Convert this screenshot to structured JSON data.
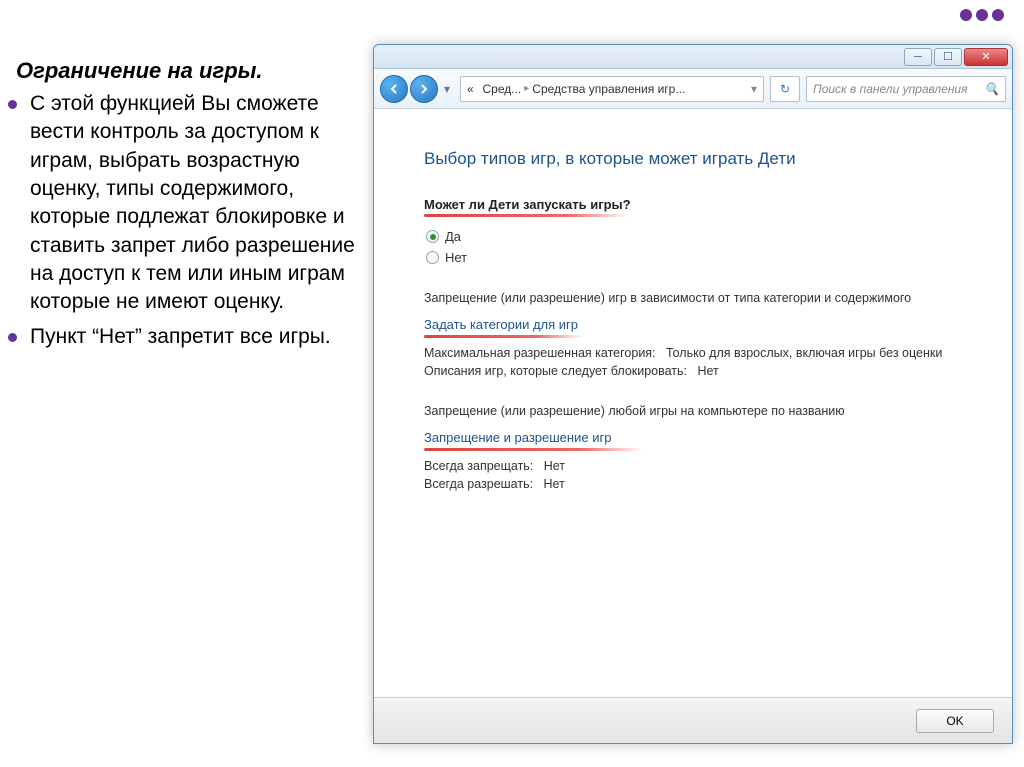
{
  "slide": {
    "title": "Ограничение на игры.",
    "bullets": [
      "С этой функцией Вы сможете вести контроль за доступом к играм, выбрать возрастную оценку, типы содержимого, которые подлежат блокировке и ставить запрет либо разрешение на доступ к тем или иным играм которые не имеют оценку.",
      "Пункт “Нет” запретит все игры."
    ]
  },
  "window": {
    "breadcrumb": {
      "part1": "Сред...",
      "part2": "Средства управления игр..."
    },
    "search_placeholder": "Поиск в панели управления",
    "heading": "Выбор типов игр, в которые может играть Дети",
    "question": "Может ли Дети запускать игры?",
    "radio_yes": "Да",
    "radio_no": "Нет",
    "section1_desc": "Запрещение (или разрешение) игр в зависимости от типа категории и содержимого",
    "link1": "Задать категории для игр",
    "max_cat_label": "Максимальная разрешенная категория:",
    "max_cat_value": "Только для взрослых, включая игры без оценки",
    "block_desc_label": "Описания игр, которые следует блокировать:",
    "block_desc_value": "Нет",
    "section2_desc": "Запрещение (или разрешение) любой игры на компьютере по названию",
    "link2": "Запрещение и разрешение игр",
    "always_block_label": "Всегда запрещать:",
    "always_block_value": "Нет",
    "always_allow_label": "Всегда разрешать:",
    "always_allow_value": "Нет",
    "ok_button": "OK"
  }
}
